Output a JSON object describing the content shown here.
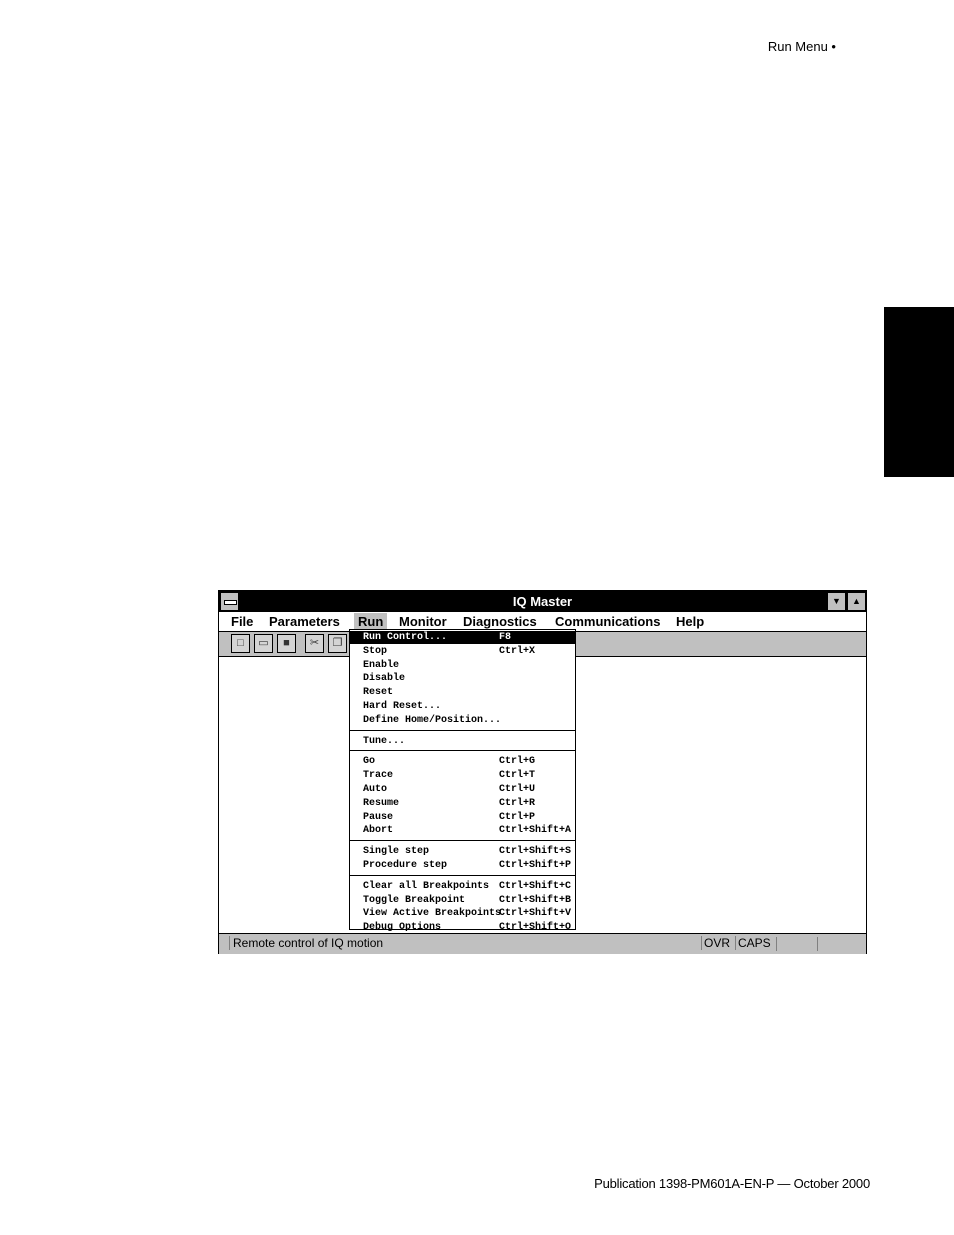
{
  "page": {
    "header": "Run Menu •",
    "footer": "Publication 1398-PM601A-EN-P — October 2000"
  },
  "window": {
    "title": "IQ Master",
    "sys_icon": "system-menu-icon",
    "min_glyph": "▼",
    "max_glyph": "▲"
  },
  "menubar": {
    "items": [
      "File",
      "Parameters",
      "Run",
      "Monitor",
      "Diagnostics",
      "Communications",
      "Help"
    ],
    "active": "Run"
  },
  "toolbar": {
    "buttons": [
      {
        "icon": "new-file-icon",
        "glyph": "□"
      },
      {
        "icon": "open-folder-icon",
        "glyph": "▭"
      },
      {
        "icon": "save-icon",
        "glyph": "■"
      },
      {
        "icon": "cut-icon",
        "glyph": "✂"
      },
      {
        "icon": "copy-icon",
        "glyph": "❐"
      }
    ]
  },
  "run_menu": {
    "groups": [
      [
        {
          "label": "Run Control...",
          "shortcut": "F8",
          "selected": true
        },
        {
          "label": "Stop",
          "shortcut": "Ctrl+X"
        },
        {
          "label": "Enable",
          "shortcut": ""
        },
        {
          "label": "Disable",
          "shortcut": ""
        },
        {
          "label": "Reset",
          "shortcut": ""
        },
        {
          "label": "Hard Reset...",
          "shortcut": ""
        },
        {
          "label": "Define Home/Position...",
          "shortcut": ""
        }
      ],
      [
        {
          "label": "Tune...",
          "shortcut": ""
        }
      ],
      [
        {
          "label": "Go",
          "shortcut": "Ctrl+G"
        },
        {
          "label": "Trace",
          "shortcut": "Ctrl+T"
        },
        {
          "label": "Auto",
          "shortcut": "Ctrl+U"
        },
        {
          "label": "Resume",
          "shortcut": "Ctrl+R"
        },
        {
          "label": "Pause",
          "shortcut": "Ctrl+P"
        },
        {
          "label": "Abort",
          "shortcut": "Ctrl+Shift+A"
        }
      ],
      [
        {
          "label": "Single step",
          "shortcut": "Ctrl+Shift+S"
        },
        {
          "label": "Procedure step",
          "shortcut": "Ctrl+Shift+P"
        }
      ],
      [
        {
          "label": "Clear all Breakpoints",
          "shortcut": "Ctrl+Shift+C"
        },
        {
          "label": "Toggle Breakpoint",
          "shortcut": "Ctrl+Shift+B"
        },
        {
          "label": "View Active Breakpoints",
          "shortcut": "Ctrl+Shift+V"
        },
        {
          "label": "Debug Options",
          "shortcut": "Ctrl+Shift+O"
        }
      ]
    ]
  },
  "statusbar": {
    "message": "Remote control of IQ motion",
    "ovr": "OVR",
    "caps": "CAPS"
  }
}
